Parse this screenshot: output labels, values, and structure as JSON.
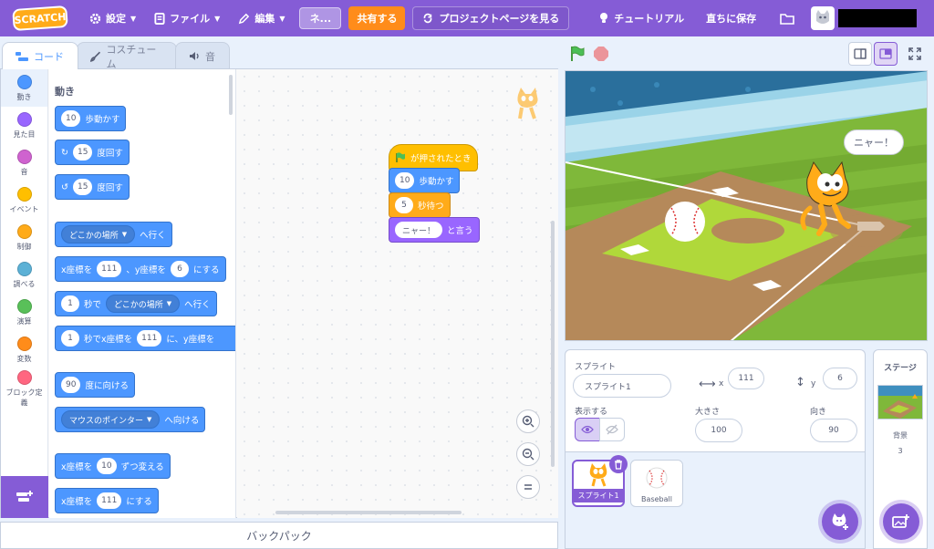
{
  "menubar": {
    "logo": "SCRATCH",
    "settings": "設定",
    "file": "ファイル",
    "edit": "編集",
    "project_title": "ネ...",
    "share": "共有する",
    "project_page": "プロジェクトページを見る",
    "tutorials": "チュートリアル",
    "save_now": "直ちに保存"
  },
  "tabs": {
    "code": "コード",
    "costumes": "コスチューム",
    "sounds": "音"
  },
  "categories": [
    {
      "label": "動き",
      "color": "#4c97ff"
    },
    {
      "label": "見た目",
      "color": "#9966ff"
    },
    {
      "label": "音",
      "color": "#cf63cf"
    },
    {
      "label": "イベント",
      "color": "#ffbf00"
    },
    {
      "label": "制御",
      "color": "#ffab19"
    },
    {
      "label": "調べる",
      "color": "#5cb1d6"
    },
    {
      "label": "演算",
      "color": "#59c059"
    },
    {
      "label": "変数",
      "color": "#ff8c1a"
    },
    {
      "label": "ブロック定義",
      "color": "#ff6680"
    }
  ],
  "palette": {
    "title": "動き",
    "move": {
      "num": "10",
      "text": "歩動かす"
    },
    "turn_right": {
      "num": "15",
      "text": "度回す"
    },
    "turn_left": {
      "num": "15",
      "text": "度回す"
    },
    "goto": {
      "dd": "どこかの場所",
      "text": "へ行く"
    },
    "goto_xy": {
      "t1": "x座標を",
      "x": "111",
      "t2": "、y座標を",
      "y": "6",
      "t3": "にする"
    },
    "glide": {
      "num": "1",
      "t1": "秒で",
      "dd": "どこかの場所",
      "t2": "へ行く"
    },
    "glide_xy": {
      "num": "1",
      "t1": "秒でx座標を",
      "x": "111",
      "t2": "に、y座標を"
    },
    "point": {
      "num": "90",
      "text": "度に向ける"
    },
    "point_towards": {
      "dd": "マウスのポインター",
      "text": "へ向ける"
    },
    "change_x": {
      "t1": "x座標を",
      "num": "10",
      "t2": "ずつ変える"
    },
    "set_x": {
      "t1": "x座標を",
      "num": "111",
      "t2": "にする"
    }
  },
  "script": {
    "hat": "が押されたとき",
    "move": {
      "num": "10",
      "text": "歩動かす"
    },
    "wait": {
      "num": "5",
      "text": "秒待つ"
    },
    "say": {
      "val": "ニャー！",
      "text": "と言う"
    }
  },
  "backpack": "バックパック",
  "stage": {
    "speech": "ニャー！"
  },
  "sprite_info": {
    "sprite_label": "スプライト",
    "sprite_name": "スプライト1",
    "x_label": "x",
    "x": "111",
    "y_label": "y",
    "y": "6",
    "show_label": "表示する",
    "size_label": "大きさ",
    "size": "100",
    "direction_label": "向き",
    "direction": "90"
  },
  "sprites": [
    {
      "name": "スプライト1",
      "selected": true
    },
    {
      "name": "Baseball",
      "selected": false
    }
  ],
  "stage_panel": {
    "title": "ステージ",
    "backdrop_label": "背景",
    "backdrop_count": "3"
  }
}
